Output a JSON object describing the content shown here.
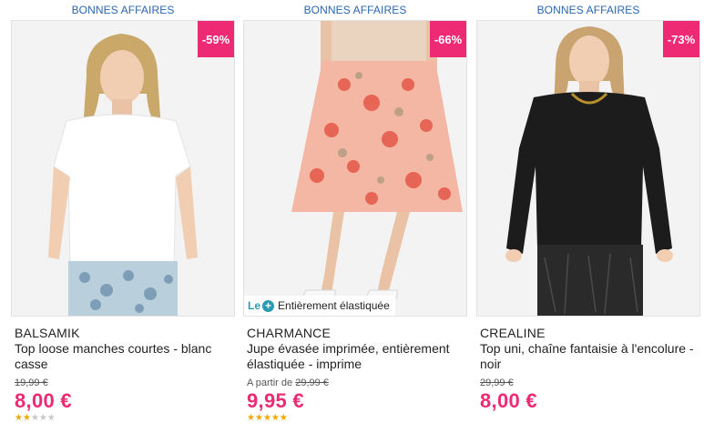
{
  "products": [
    {
      "section_label": "BONNES AFFAIRES",
      "discount": "-59%",
      "brand": "BALSAMIK",
      "title": "Top loose manches courtes - blanc casse",
      "old_price": "19,99 €",
      "price_prefix": "",
      "new_price": "8,00 €",
      "rating": 2,
      "rating_max": 5
    },
    {
      "section_label": "BONNES AFFAIRES",
      "discount": "-66%",
      "promo_le": "Le",
      "promo_text": "Entièrement élastiquée",
      "brand": "CHARMANCE",
      "title": "Jupe évasée imprimée, entièrement élastiquée - imprime",
      "price_prefix": "A partir de",
      "old_price": "29,99 €",
      "new_price": "9,95 €",
      "rating": 5,
      "rating_max": 5
    },
    {
      "section_label": "BONNES AFFAIRES",
      "discount": "-73%",
      "brand": "CREALINE",
      "title": "Top uni, chaîne fantaisie à l'encolure - noir",
      "old_price": "29,99 €",
      "price_prefix": "",
      "new_price": "8,00 €",
      "rating": 0,
      "rating_max": 5
    }
  ],
  "colors": {
    "accent_pink": "#ee2a74",
    "link_blue": "#2a66b0",
    "star_gold": "#f0a800",
    "promo_teal": "#2a9bb0"
  }
}
